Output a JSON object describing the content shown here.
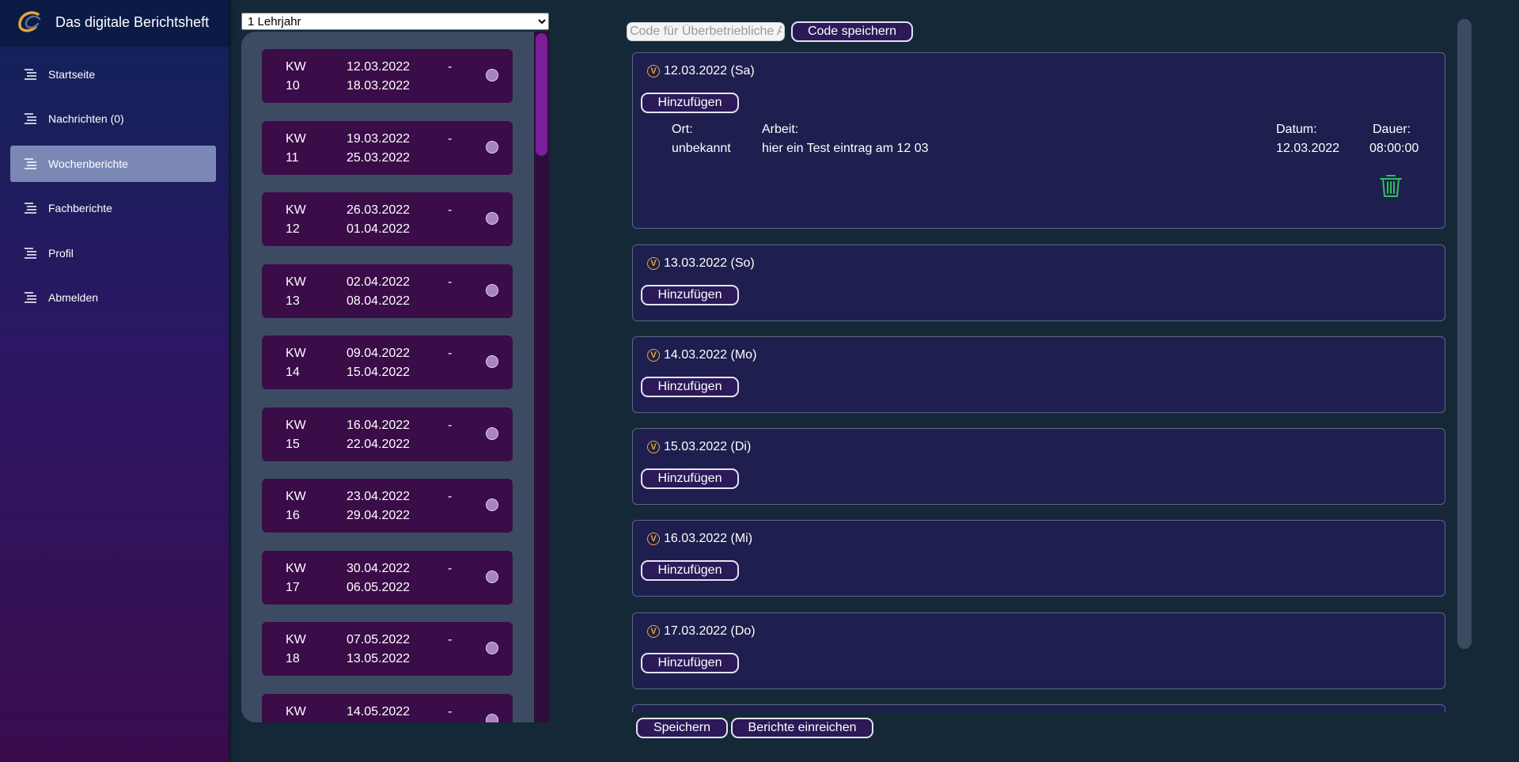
{
  "app": {
    "title": "Das digitale Berichtsheft"
  },
  "sidebar": {
    "items": [
      {
        "label": "Startseite"
      },
      {
        "label": "Nachrichten (0)"
      },
      {
        "label": "Wochenberichte",
        "active": true
      },
      {
        "label": "Fachberichte"
      },
      {
        "label": "Profil"
      },
      {
        "label": "Abmelden"
      }
    ]
  },
  "year_select": {
    "selected": "1 Lehrjahr"
  },
  "weeks": [
    {
      "kw": "KW",
      "num": "10",
      "start": "12.03.2022",
      "dash": "-",
      "end": "18.03.2022"
    },
    {
      "kw": "KW",
      "num": "11",
      "start": "19.03.2022",
      "dash": "-",
      "end": "25.03.2022"
    },
    {
      "kw": "KW",
      "num": "12",
      "start": "26.03.2022",
      "dash": "-",
      "end": "01.04.2022"
    },
    {
      "kw": "KW",
      "num": "13",
      "start": "02.04.2022",
      "dash": "-",
      "end": "08.04.2022"
    },
    {
      "kw": "KW",
      "num": "14",
      "start": "09.04.2022",
      "dash": "-",
      "end": "15.04.2022"
    },
    {
      "kw": "KW",
      "num": "15",
      "start": "16.04.2022",
      "dash": "-",
      "end": "22.04.2022"
    },
    {
      "kw": "KW",
      "num": "16",
      "start": "23.04.2022",
      "dash": "-",
      "end": "29.04.2022"
    },
    {
      "kw": "KW",
      "num": "17",
      "start": "30.04.2022",
      "dash": "-",
      "end": "06.05.2022"
    },
    {
      "kw": "KW",
      "num": "18",
      "start": "07.05.2022",
      "dash": "-",
      "end": "13.05.2022"
    },
    {
      "kw": "KW",
      "num": "",
      "start": "14.05.2022",
      "dash": "-",
      "end": ""
    }
  ],
  "code": {
    "placeholder": "Code für Überbetriebliche A",
    "save_label": "Code speichern"
  },
  "days": [
    {
      "date": "12.03.2022 (Sa)",
      "add_label": "Hinzufügen",
      "entry": {
        "ort_label": "Ort:",
        "ort": "unbekannt",
        "arbeit_label": "Arbeit:",
        "arbeit": "hier ein Test eintrag am 12 03",
        "datum_label": "Datum:",
        "datum": "12.03.2022",
        "dauer_label": "Dauer:",
        "dauer": "08:00:00"
      }
    },
    {
      "date": "13.03.2022 (So)",
      "add_label": "Hinzufügen"
    },
    {
      "date": "14.03.2022 (Mo)",
      "add_label": "Hinzufügen"
    },
    {
      "date": "15.03.2022 (Di)",
      "add_label": "Hinzufügen"
    },
    {
      "date": "16.03.2022 (Mi)",
      "add_label": "Hinzufügen"
    },
    {
      "date": "17.03.2022 (Do)",
      "add_label": "Hinzufügen"
    }
  ],
  "bottom": {
    "save_label": "Speichern",
    "submit_label": "Berichte einreichen"
  },
  "colors": {
    "accent_purple": "#3a0c48",
    "active_nav": "#7b88b6",
    "expand_icon": "#f0a62a",
    "delete_icon": "#2fbf5c"
  },
  "icons": {
    "expand": "V",
    "delete": "trash-icon",
    "nav": "menu-lines-icon"
  }
}
